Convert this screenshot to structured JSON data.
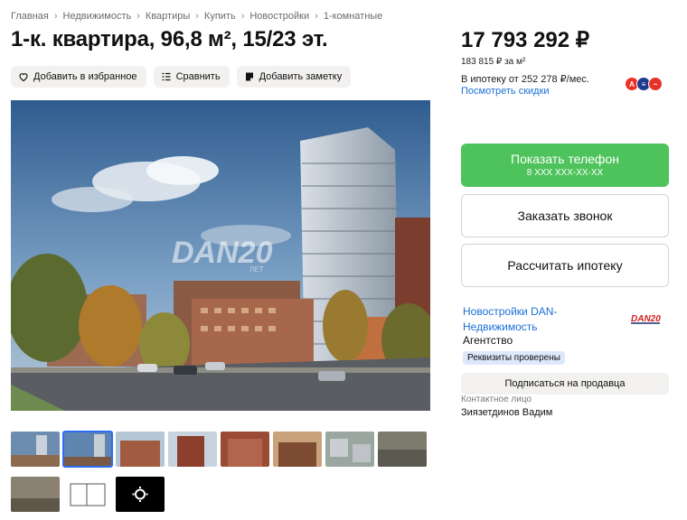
{
  "breadcrumb": [
    "Главная",
    "Недвижимость",
    "Квартиры",
    "Купить",
    "Новостройки",
    "1-комнатные"
  ],
  "title": "1-к. квартира, 96,8 м², 15/23 эт.",
  "actions": {
    "favorite": "Добавить в избранное",
    "compare": "Сравнить",
    "note": "Добавить заметку"
  },
  "photo": {
    "watermark": "DAN20",
    "watermark_sub": "ЛЕТ"
  },
  "price": {
    "total": "17 793 292 ₽",
    "per_m2": "183 815 ₽ за м²",
    "mortgage": "В ипотеку от 252 278 ₽/мес.",
    "discount_link": "Посмотреть скидки"
  },
  "banks": [
    {
      "letter": "А",
      "color": "#ef3124"
    },
    {
      "letter": "≡",
      "color": "#1f3b8f"
    },
    {
      "letter": "~",
      "color": "#e5332a"
    }
  ],
  "contact": {
    "show_phone": "Показать телефон",
    "phone_mask": "8 XXX XXX-XX-XX",
    "call_back": "Заказать звонок",
    "calc_mortgage": "Рассчитать ипотеку"
  },
  "seller": {
    "name": "Новостройки DAN-Недвижимость",
    "logo_text": "DAN20",
    "type": "Агентство",
    "verified": "Реквизиты проверены",
    "subscribe": "Подписаться на продавца",
    "contact_label": "Контактное лицо",
    "contact_name": "Зиязетдинов Вадим"
  },
  "colors": {
    "accent_green": "#4ec35c",
    "link_blue": "#1a6fd6",
    "chip_bg": "#f2f1ef"
  }
}
